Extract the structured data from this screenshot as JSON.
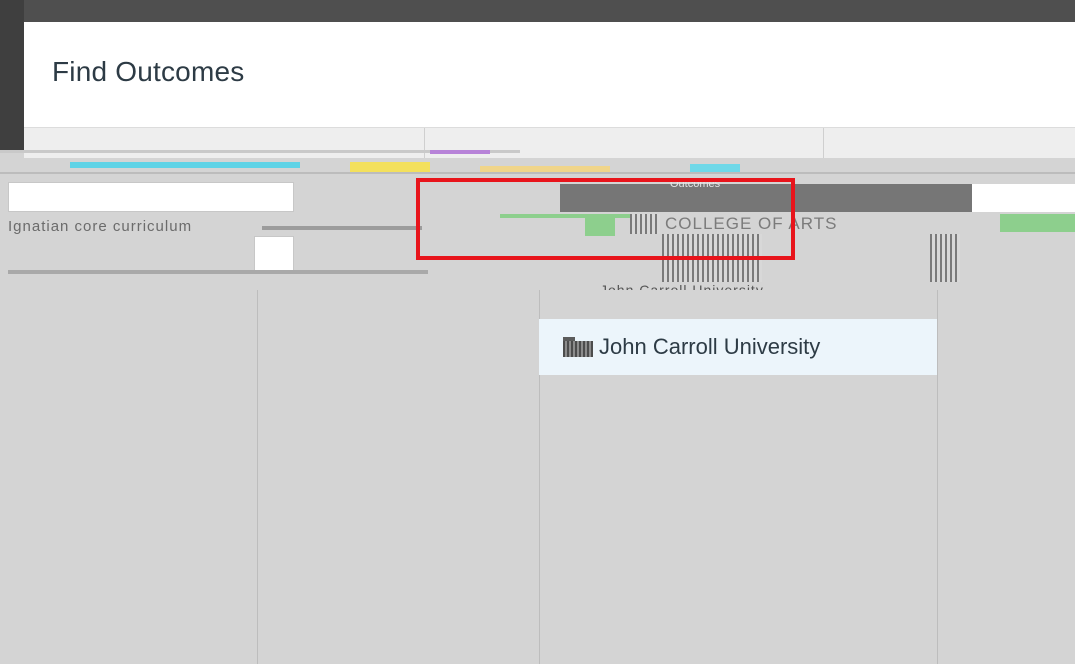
{
  "dialog": {
    "title": "Find Outcomes"
  },
  "toolbar": {
    "search_text": "Ignatian core curriculum",
    "college_label": "COLLEGE OF ARTS",
    "dark_bar_label": "Outcomes",
    "subheading": "John Carroll University"
  },
  "tree": {
    "selected_item": {
      "label": "John Carroll University",
      "icon": "folder-icon"
    }
  },
  "colors": {
    "highlight": "#e8141b",
    "selected_row": "#ecf5fb",
    "text": "#2d3b45"
  }
}
